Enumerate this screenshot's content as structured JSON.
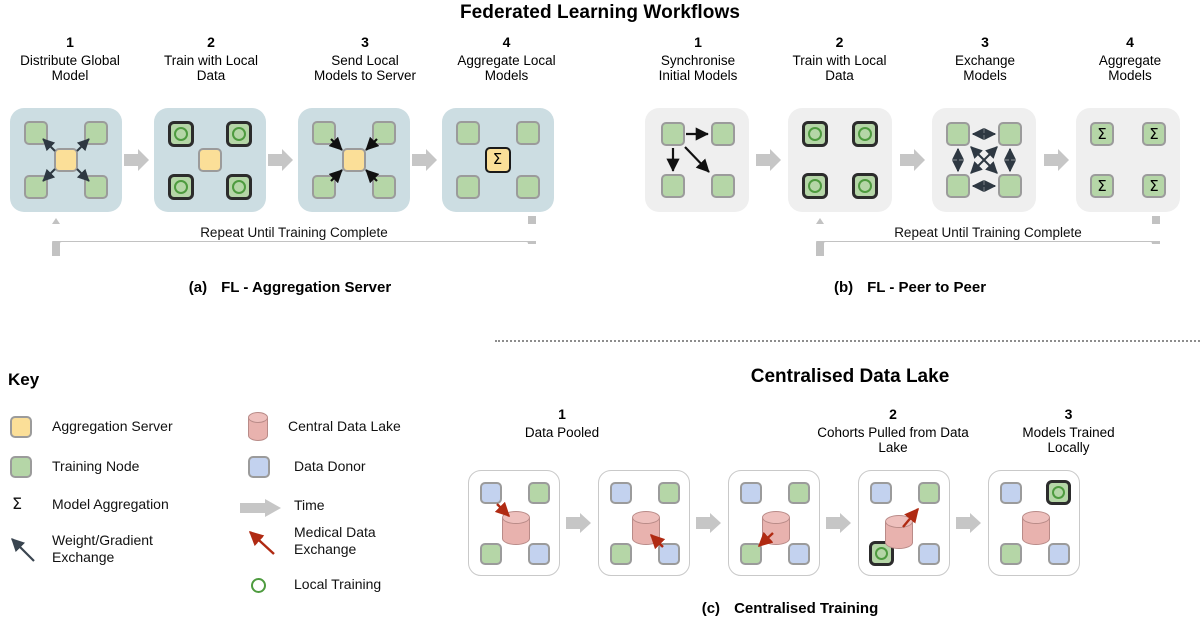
{
  "main_title": "Federated Learning Workflows",
  "panel_a": {
    "caption_letter": "(a)",
    "caption_text": "FL - Aggregation Server",
    "loop_label": "Repeat Until Training Complete",
    "steps": [
      {
        "num": "1",
        "label": "Distribute Global\nModel"
      },
      {
        "num": "2",
        "label": "Train with Local\nData"
      },
      {
        "num": "3",
        "label": "Send Local\nModels to Server"
      },
      {
        "num": "4",
        "label": "Aggregate Local\nModels"
      }
    ],
    "sigma_symbol": "Σ"
  },
  "panel_b": {
    "caption_letter": "(b)",
    "caption_text": "FL - Peer to Peer",
    "loop_label": "Repeat Until Training Complete",
    "steps": [
      {
        "num": "1",
        "label": "Synchronise\nInitial Models"
      },
      {
        "num": "2",
        "label": "Train with Local\nData"
      },
      {
        "num": "3",
        "label": "Exchange\nModels"
      },
      {
        "num": "4",
        "label": "Aggregate\nModels"
      }
    ],
    "sigma_symbol": "Σ"
  },
  "panel_c": {
    "section_title": "Centralised Data Lake",
    "caption_letter": "(c)",
    "caption_text": "Centralised Training",
    "steps": [
      {
        "num": "1",
        "label": "Data Pooled"
      },
      {
        "num": "2",
        "label": "Cohorts Pulled from Data\nLake"
      },
      {
        "num": "3",
        "label": "Models Trained\nLocally"
      }
    ]
  },
  "key": {
    "title": "Key",
    "sigma_symbol": "Σ",
    "left_items": [
      {
        "icon": "aggregation-server-swatch",
        "label": "Aggregation Server"
      },
      {
        "icon": "training-node-swatch",
        "label": "Training Node"
      },
      {
        "icon": "sigma-glyph",
        "label": "Model Aggregation"
      },
      {
        "icon": "gradient-arrow-icon",
        "label": "Weight/Gradient\nExchange"
      }
    ],
    "right_items": [
      {
        "icon": "data-lake-cylinder-icon",
        "label": "Central Data Lake"
      },
      {
        "icon": "data-donor-swatch",
        "label": "Data Donor"
      },
      {
        "icon": "time-arrow-icon",
        "label": "Time"
      },
      {
        "icon": "medical-data-arrow-icon",
        "label": "Medical Data\nExchange"
      },
      {
        "icon": "local-training-ring-icon",
        "label": "Local Training"
      }
    ]
  },
  "colors": {
    "aggregation_server": "#fbdf98",
    "training_node": "#b5d6a7",
    "data_donor": "#c3d2ef",
    "data_lake": "#e8b2ae",
    "stage_blue": "#ccdde2",
    "stage_gray": "#efefef",
    "time_arrow": "#c6c6c6",
    "medical_arrow": "#b02a12",
    "gradient_arrow": "#3a4550",
    "local_training_ring": "#4e9b3f"
  }
}
